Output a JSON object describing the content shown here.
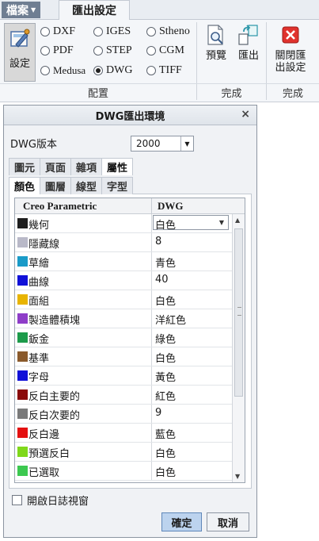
{
  "ribbon": {
    "file_tab": "檔案",
    "export_tab": "匯出設定",
    "settings_button": "設定",
    "formats": [
      {
        "label": "DXF",
        "checked": false
      },
      {
        "label": "IGES",
        "checked": false
      },
      {
        "label": "Stheno",
        "checked": false
      },
      {
        "label": "PDF",
        "checked": false
      },
      {
        "label": "STEP",
        "checked": false
      },
      {
        "label": "CGM",
        "checked": false
      },
      {
        "label": "Medusa",
        "checked": false
      },
      {
        "label": "DWG",
        "checked": true
      },
      {
        "label": "TIFF",
        "checked": false
      }
    ],
    "group_config": "配置",
    "preview_button": "預覽",
    "export_button": "匯出",
    "close_button": "關閉匯出設定",
    "group_finish1": "完成",
    "group_finish2": "完成"
  },
  "dialog": {
    "title": "DWG匯出環境",
    "close": "×",
    "version_label": "DWG版本",
    "version_value": "2000",
    "tabs1": [
      "圖元",
      "頁面",
      "雜項",
      "屬性"
    ],
    "tabs2": [
      "顏色",
      "圖層",
      "線型",
      "字型"
    ],
    "col_creo": "Creo Parametric",
    "col_dwg": "DWG",
    "rows": [
      {
        "name": "幾何",
        "value": "白色",
        "color": "#1e1e1e"
      },
      {
        "name": "隱藏線",
        "value": "8",
        "color": "#b9b9c8"
      },
      {
        "name": "草繪",
        "value": "青色",
        "color": "#1a9bc8"
      },
      {
        "name": "曲線",
        "value": "40",
        "color": "#1010d8"
      },
      {
        "name": "面組",
        "value": "白色",
        "color": "#e8b400"
      },
      {
        "name": "製造體積塊",
        "value": "洋紅色",
        "color": "#8e3dc8"
      },
      {
        "name": "鈑金",
        "value": "綠色",
        "color": "#1c9a4a"
      },
      {
        "name": "基準",
        "value": "白色",
        "color": "#8a5a2c"
      },
      {
        "name": "字母",
        "value": "黃色",
        "color": "#1010d8"
      },
      {
        "name": "反白主要的",
        "value": "紅色",
        "color": "#8a0a0a"
      },
      {
        "name": "反白次要的",
        "value": "9",
        "color": "#7a7a7a"
      },
      {
        "name": "反白邊",
        "value": "藍色",
        "color": "#e41010"
      },
      {
        "name": "預選反白",
        "value": "白色",
        "color": "#7fd81a"
      },
      {
        "name": "已選取",
        "value": "白色",
        "color": "#3cc850"
      }
    ],
    "log_label": "開啟日誌視窗",
    "ok": "確定",
    "cancel": "取消"
  }
}
